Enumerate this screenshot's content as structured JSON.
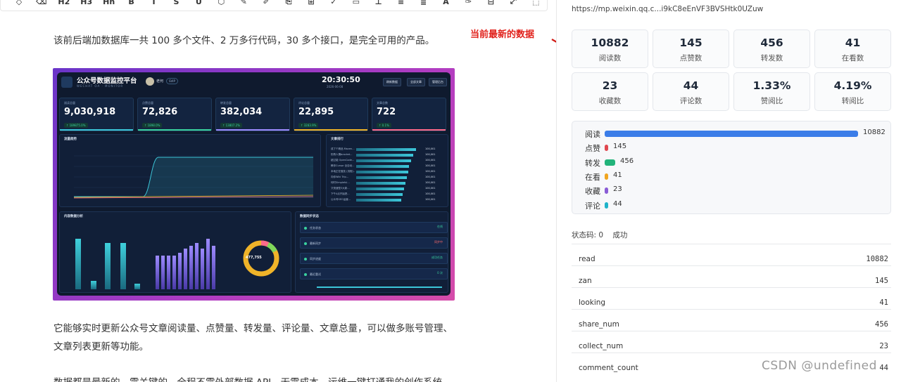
{
  "toolbar": {
    "items": [
      "◇",
      "⌫",
      "H2",
      "H3",
      "Hn",
      "B",
      "I",
      "S",
      "U",
      "⬡",
      "✎",
      "✐",
      "⎘",
      "⊞",
      "✓",
      "▭",
      "⊥",
      "≡",
      "≣",
      "A",
      "✑",
      "⊟",
      "⤢",
      "⬚"
    ]
  },
  "article": {
    "para1": "该前后端加数据库一共 100 多个文件、2 万多行代码，30 多个接口，是完全可用的产品。",
    "para2": "它能够实时更新公众号文章阅读量、点赞量、转发量、评论量、文章总量，可以做多账号管理、文章列表更新等功能。",
    "para3": "数据都是最新的，需关键的，全程不需外部数据 API，无需成本，运维一键打通我的创作系统"
  },
  "dashboard": {
    "title": "公众号数据监控平台",
    "subtitle": "WECHAT OA · MONITOR",
    "user": "老何",
    "vip": "SVIP",
    "clock": "20:30:50",
    "date": "2026-06-08",
    "buttons": [
      "刷新数据",
      "全部文章",
      "管理后台"
    ],
    "kpis": [
      {
        "label": "阅读总量",
        "value": "9,030,918",
        "tag": "↑ 189875.0%",
        "color": "#3cc6d9"
      },
      {
        "label": "点赞总量",
        "value": "72,826",
        "tag": "↑ 1898.0%",
        "color": "#3ad29f"
      },
      {
        "label": "转发总量",
        "value": "382,034",
        "tag": "↑ 13807.2%",
        "color": "#9d8bff"
      },
      {
        "label": "评论总量",
        "value": "22,895",
        "tag": "↑ 3283.9%",
        "color": "#f0b429"
      },
      {
        "label": "文章总数",
        "value": "722",
        "tag": "↑ 0.1%",
        "color": "#ff6a8a"
      }
    ],
    "trend_title": "流量趋势",
    "rank_title": "文章排行",
    "rank": [
      {
        "label": "成了个精品 Maven...",
        "value": "100,001",
        "pct": 0.92
      },
      {
        "label": "别再人猜bracket...",
        "value": "100,001",
        "pct": 0.88
      },
      {
        "label": "超过能 OpenCode...",
        "value": "100,001",
        "pct": 0.85
      },
      {
        "label": "教你Cursor 全自动...",
        "value": "100,001",
        "pct": 0.82
      },
      {
        "label": "本地正在做技 (流程)...",
        "value": "100,001",
        "pct": 0.8
      },
      {
        "label": "向你Wiki Trip...",
        "value": "100,001",
        "pct": 0.78
      },
      {
        "label": "何时Simpleful...",
        "value": "100,001",
        "pct": 0.76
      },
      {
        "label": "又快速型3大新...",
        "value": "100,001",
        "pct": 0.74
      },
      {
        "label": "下午4点开始把...",
        "value": "100,001",
        "pct": 0.72
      },
      {
        "label": "公众号SEO运营...",
        "value": "100,001",
        "pct": 0.7
      }
    ],
    "content_title": "内容数据分析",
    "sync_title": "数据同步状态",
    "donut_value": "477,755",
    "sync_rows": [
      {
        "label": "任务状态",
        "stat": "在线",
        "warn": false
      },
      {
        "label": "最新同步",
        "stat": "同步中",
        "warn": true
      },
      {
        "label": "同步进度",
        "stat": "成功任务",
        "warn": false
      },
      {
        "label": "最近重试",
        "stat": "0 次",
        "warn": false
      }
    ]
  },
  "annotation": {
    "label": "当前最新的数据"
  },
  "right": {
    "url": "https://mp.weixin.qq.c...i9kC8eEnVF3BVSHtk0UZuw",
    "stats": [
      {
        "value": "10882",
        "label": "阅读数"
      },
      {
        "value": "145",
        "label": "点赞数"
      },
      {
        "value": "456",
        "label": "转发数"
      },
      {
        "value": "41",
        "label": "在看数"
      },
      {
        "value": "23",
        "label": "收藏数"
      },
      {
        "value": "44",
        "label": "评论数"
      },
      {
        "value": "1.33%",
        "label": "赞阅比"
      },
      {
        "value": "4.19%",
        "label": "转阅比"
      }
    ],
    "bars": [
      {
        "label": "阅读",
        "value": "10882",
        "num": 10882,
        "color": "#3b7de8"
      },
      {
        "label": "点赞",
        "value": "145",
        "num": 145,
        "color": "#e0474f"
      },
      {
        "label": "转发",
        "value": "456",
        "num": 456,
        "color": "#22b37a"
      },
      {
        "label": "在看",
        "value": "41",
        "num": 41,
        "color": "#f0a520"
      },
      {
        "label": "收藏",
        "value": "23",
        "num": 23,
        "color": "#8a5cd6"
      },
      {
        "label": "评论",
        "value": "44",
        "num": 44,
        "color": "#1fb3c9"
      }
    ],
    "status_label": "状态码: 0",
    "status_text": "成功",
    "rows": [
      {
        "key": "read",
        "value": "10882"
      },
      {
        "key": "zan",
        "value": "145"
      },
      {
        "key": "looking",
        "value": "41"
      },
      {
        "key": "share_num",
        "value": "456"
      },
      {
        "key": "collect_num",
        "value": "23"
      },
      {
        "key": "comment_count",
        "value": "44"
      }
    ]
  },
  "watermark": "CSDN @undefined"
}
